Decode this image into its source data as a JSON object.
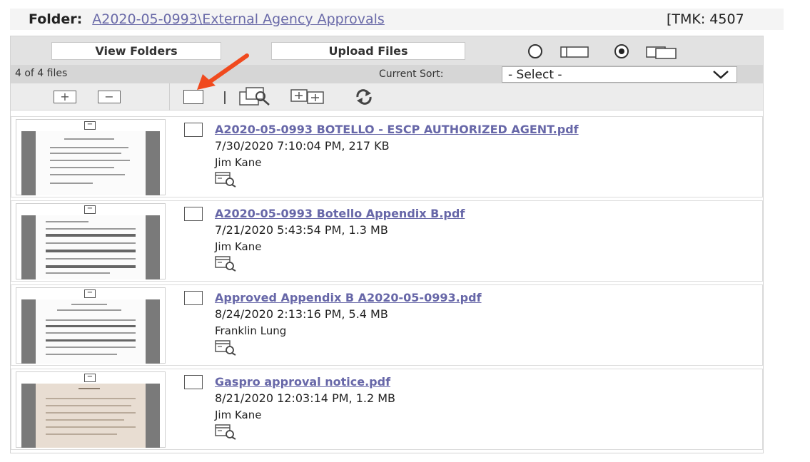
{
  "folder": {
    "label": "Folder:",
    "path": "A2020-05-0993\\External Agency Approvals",
    "tmk": "[TMK: 4507"
  },
  "toolbar": {
    "view_folders": "View Folders",
    "upload_files": "Upload Files",
    "view_mode_selected": "thumbnails"
  },
  "status": {
    "files_count": "4 of 4 files",
    "sort_label": "Current Sort:",
    "sort_value": "- Select -"
  },
  "files": [
    {
      "name": "A2020-05-0993 BOTELLO - ESCP AUTHORIZED AGENT.pdf",
      "meta": "7/30/2020 7:10:04 PM, 217 KB",
      "author": "Jim Kane"
    },
    {
      "name": "A2020-05-0993 Botello Appendix B.pdf",
      "meta": "7/21/2020 5:43:54 PM, 1.3 MB",
      "author": "Jim Kane"
    },
    {
      "name": "Approved Appendix B A2020-05-0993.pdf",
      "meta": "8/24/2020 2:13:16 PM, 5.4 MB",
      "author": "Franklin Lung"
    },
    {
      "name": "Gaspro approval notice.pdf",
      "meta": "8/21/2020 12:03:14 PM, 1.2 MB",
      "author": "Jim Kane"
    }
  ],
  "colors": {
    "link": "#6767a8",
    "annotation_arrow": "#f04a1e"
  }
}
